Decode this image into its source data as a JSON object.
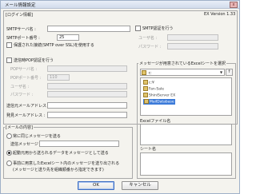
{
  "window": {
    "title": "メール情報設定",
    "close_icon": "x"
  },
  "login": {
    "legend": "[ログイン情報]",
    "smtp_server_label": "SMTPサーバ名 :",
    "smtp_server_value": "",
    "smtp_port_label": "SMTPポート番号 :",
    "smtp_port_value": "25",
    "ssl_label": "保護された接続(SMTP over SSL)を使用する",
    "version": "EX Version 1.33",
    "smtp_auth_label": "SMTP認証を行う",
    "user_label": "ユーザ名 :",
    "password_label": "パスワード :",
    "pop_before_label": "送信時POP認証を行う",
    "pop_server_label": "POPサーバ名 :",
    "pop_port_label": "POPポート番号 :",
    "pop_port_value": "110",
    "pop_user_label": "ユーザ名 :",
    "pop_password_label": "パスワード :",
    "sender_label": "送信元メールアドレス :",
    "from_label": "発見メールアドレス :"
  },
  "mail": {
    "legend": "[メールの内容]",
    "fixed_label": "常に同じメッセージを送る",
    "message_label": "送信メッセージ :",
    "launch_label": "起動元用から送られるデータをメッセージとして送る",
    "excel_label": "事前に用意したExcelシート内のメッセージを送り出される",
    "excel_note": "(メッセージと送り先を組織順番から指定できます)"
  },
  "excel": {
    "legend": "メッセージが用意されているExcelシートを選択",
    "drive": "c:",
    "tree_items": [
      "c:¥",
      "Fan-Sale",
      "ShiniServer EX",
      "MailDatabase"
    ],
    "file_label": "Excelファイル名",
    "sheet_label": "シート名"
  },
  "buttons": {
    "ok": "OK",
    "cancel": "キャンセル"
  }
}
